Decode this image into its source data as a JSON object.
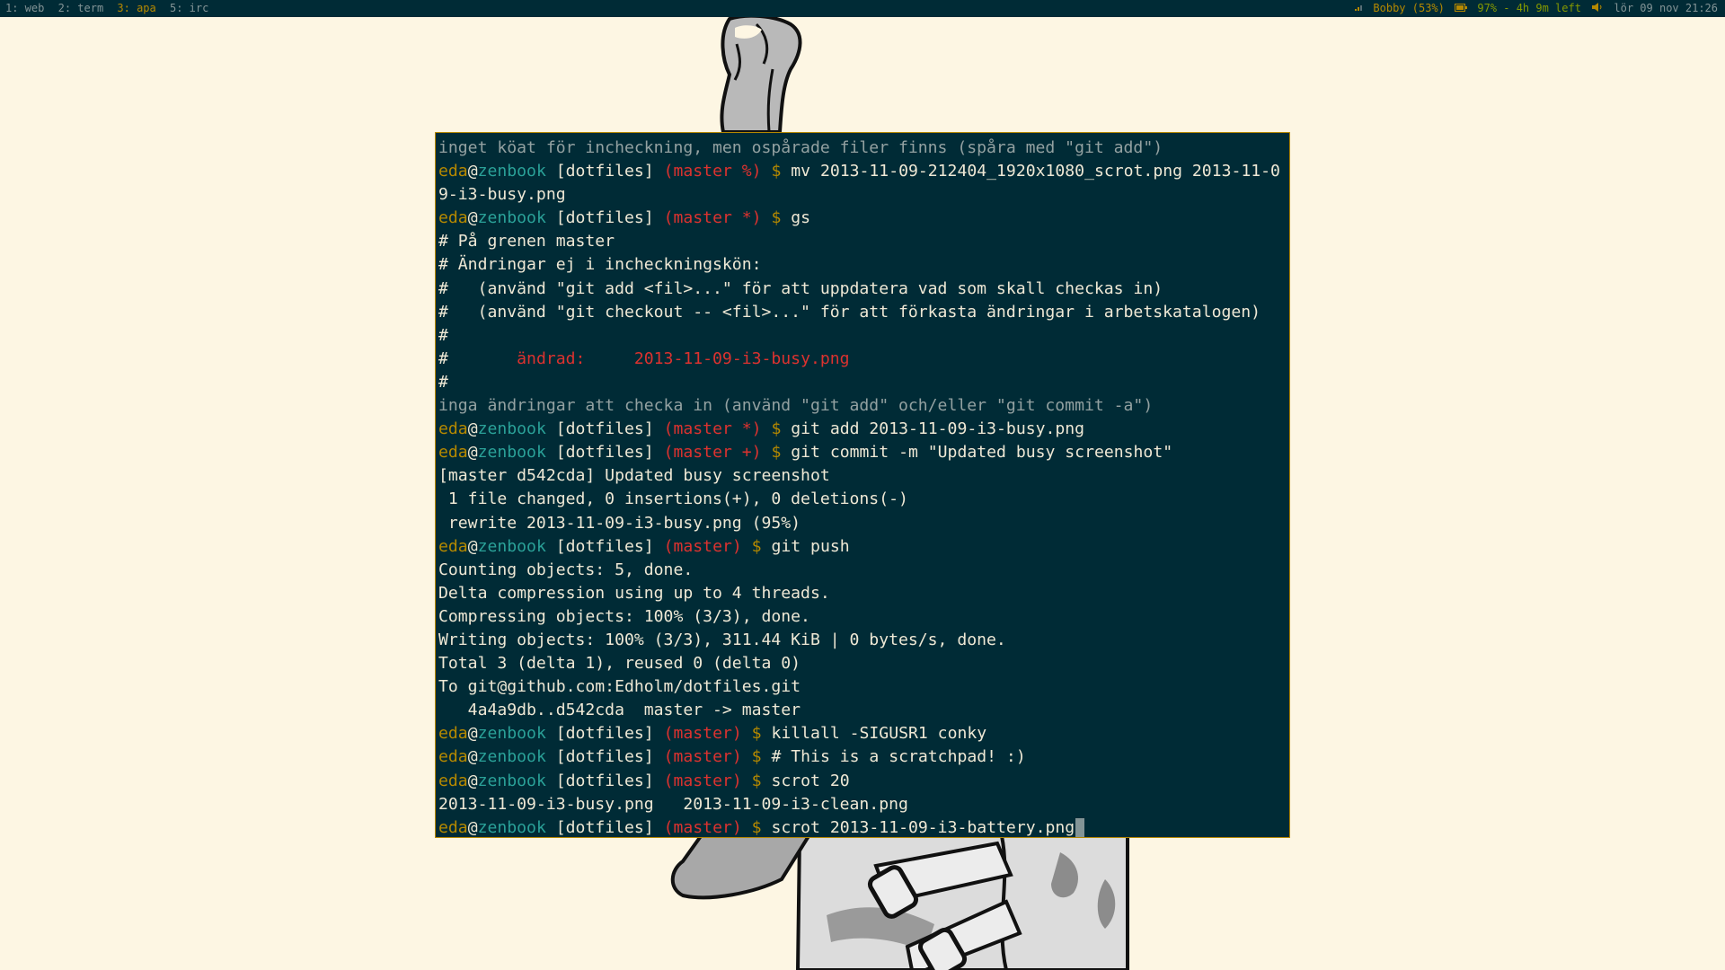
{
  "colors": {
    "desktop_bg": "#fdf6e3",
    "terminal_bg": "#002b36",
    "terminal_border": "#b58900",
    "user": "#b58900",
    "host": "#2aa198",
    "branch": "#dc322f",
    "text": "#eee8d5"
  },
  "bar": {
    "workspaces": [
      {
        "label": "1: web",
        "active": false
      },
      {
        "label": "2: term",
        "active": false
      },
      {
        "label": "3: apa",
        "active": true
      },
      {
        "label": "5: irc",
        "active": false
      }
    ],
    "status": {
      "wifi_icon": "wifi-signal-icon",
      "wifi": "Bobby (53%)",
      "battery_icon": "battery-icon",
      "battery": "97% - 4h 9m left",
      "volume_icon": "speaker-icon",
      "date": "lör 09 nov 21:26"
    }
  },
  "terminal": {
    "prompt": {
      "user": "eda",
      "at": "@",
      "host": "zenbook",
      "dir": "[dotfiles]",
      "dollar": "$"
    },
    "lines": [
      {
        "type": "gray",
        "text": "inget köat för incheckning, men ospårade filer finns (spåra med \"git add\")"
      },
      {
        "type": "prompt",
        "branch": "(master %)",
        "cmd": "mv 2013-11-09-212404_1920x1080_scrot.png 2013-11-0"
      },
      {
        "type": "text",
        "text": "9-i3-busy.png"
      },
      {
        "type": "prompt",
        "branch": "(master *)",
        "cmd": "gs"
      },
      {
        "type": "text",
        "text": "# På grenen master"
      },
      {
        "type": "text",
        "text": "# Ändringar ej i incheckningskön:"
      },
      {
        "type": "text",
        "text": "#   (använd \"git add <fil>...\" för att uppdatera vad som skall checkas in)"
      },
      {
        "type": "text",
        "text": "#   (använd \"git checkout -- <fil>...\" för att förkasta ändringar i arbetskatalogen)"
      },
      {
        "type": "text",
        "text": "#"
      },
      {
        "type": "changed",
        "hash": "#",
        "text": "       ändrad:     2013-11-09-i3-busy.png"
      },
      {
        "type": "text",
        "text": "#"
      },
      {
        "type": "gray",
        "text": "inga ändringar att checka in (använd \"git add\" och/eller \"git commit -a\")"
      },
      {
        "type": "prompt",
        "branch": "(master *)",
        "cmd": "git add 2013-11-09-i3-busy.png"
      },
      {
        "type": "prompt",
        "branch": "(master +)",
        "cmd": "git commit -m \"Updated busy screenshot\""
      },
      {
        "type": "text",
        "text": "[master d542cda] Updated busy screenshot"
      },
      {
        "type": "text",
        "text": " 1 file changed, 0 insertions(+), 0 deletions(-)"
      },
      {
        "type": "text",
        "text": " rewrite 2013-11-09-i3-busy.png (95%)"
      },
      {
        "type": "prompt",
        "branch": "(master)",
        "cmd": "git push"
      },
      {
        "type": "text",
        "text": "Counting objects: 5, done."
      },
      {
        "type": "text",
        "text": "Delta compression using up to 4 threads."
      },
      {
        "type": "text",
        "text": "Compressing objects: 100% (3/3), done."
      },
      {
        "type": "text",
        "text": "Writing objects: 100% (3/3), 311.44 KiB | 0 bytes/s, done."
      },
      {
        "type": "text",
        "text": "Total 3 (delta 1), reused 0 (delta 0)"
      },
      {
        "type": "text",
        "text": "To git@github.com:Edholm/dotfiles.git"
      },
      {
        "type": "text",
        "text": "   4a4a9db..d542cda  master -> master"
      },
      {
        "type": "prompt",
        "branch": "(master)",
        "cmd": "killall -SIGUSR1 conky"
      },
      {
        "type": "prompt",
        "branch": "(master)",
        "cmd": "# This is a scratchpad! :)"
      },
      {
        "type": "prompt",
        "branch": "(master)",
        "cmd": "scrot 20"
      },
      {
        "type": "text",
        "text": "2013-11-09-i3-busy.png   2013-11-09-i3-clean.png"
      },
      {
        "type": "prompt",
        "branch": "(master)",
        "cmd": "scrot 2013-11-09-i3-battery.png",
        "cursor": true
      }
    ]
  }
}
